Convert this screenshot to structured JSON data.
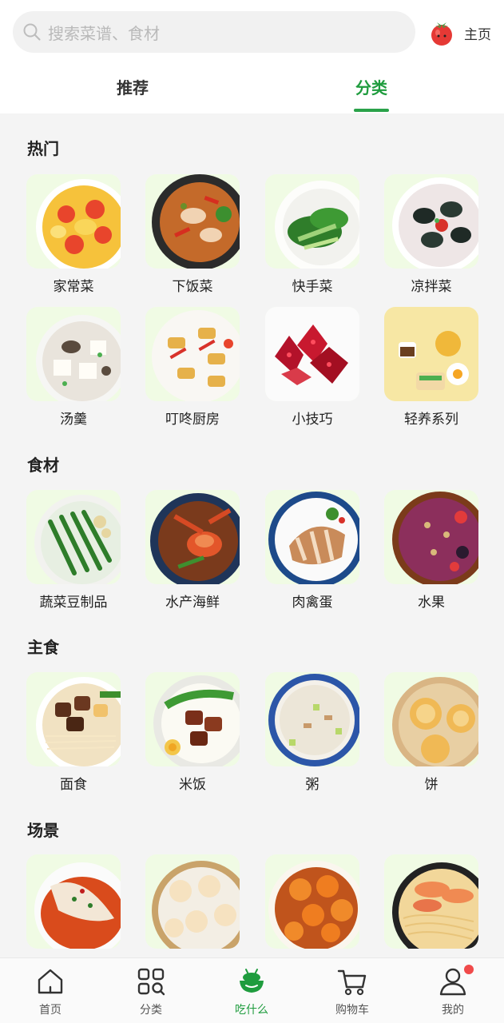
{
  "search": {
    "placeholder": "搜索菜谱、食材"
  },
  "header": {
    "home_label": "主页"
  },
  "tabs": [
    {
      "label": "推荐"
    },
    {
      "label": "分类"
    }
  ],
  "sections": [
    {
      "title": "热门",
      "items": [
        {
          "label": "家常菜",
          "image": "tomato-egg"
        },
        {
          "label": "下饭菜",
          "image": "chili-fish"
        },
        {
          "label": "快手菜",
          "image": "greens"
        },
        {
          "label": "凉拌菜",
          "image": "century-eggs"
        },
        {
          "label": "汤羹",
          "image": "tofu-soup"
        },
        {
          "label": "叮咚厨房",
          "image": "egg-rolls"
        },
        {
          "label": "小技巧",
          "image": "pomegranate"
        },
        {
          "label": "轻养系列",
          "image": "breakfast"
        }
      ]
    },
    {
      "title": "食材",
      "items": [
        {
          "label": "蔬菜豆制品",
          "image": "green-beans"
        },
        {
          "label": "水产海鲜",
          "image": "crab"
        },
        {
          "label": "肉禽蛋",
          "image": "pork-slices"
        },
        {
          "label": "水果",
          "image": "berry-bowl"
        }
      ]
    },
    {
      "title": "主食",
      "items": [
        {
          "label": "面食",
          "image": "beef-noodles"
        },
        {
          "label": "米饭",
          "image": "braised-rice"
        },
        {
          "label": "粥",
          "image": "congee"
        },
        {
          "label": "饼",
          "image": "pan-buns"
        }
      ]
    },
    {
      "title": "场景",
      "items": [
        {
          "label": "",
          "image": "steamed-fish"
        },
        {
          "label": "",
          "image": "dumplings"
        },
        {
          "label": "",
          "image": "shrimp"
        },
        {
          "label": "",
          "image": "shrimp-noodles"
        }
      ]
    }
  ],
  "bottom_nav": [
    {
      "label": "首页",
      "icon": "home-icon"
    },
    {
      "label": "分类",
      "icon": "grid-search-icon"
    },
    {
      "label": "吃什么",
      "icon": "bowl-icon",
      "active": true
    },
    {
      "label": "购物车",
      "icon": "cart-icon"
    },
    {
      "label": "我的",
      "icon": "user-icon",
      "badge": true
    }
  ],
  "colors": {
    "accent": "#1f9c3e",
    "badge": "#f04a4a",
    "thumb_bg": "#f0fbe4"
  }
}
